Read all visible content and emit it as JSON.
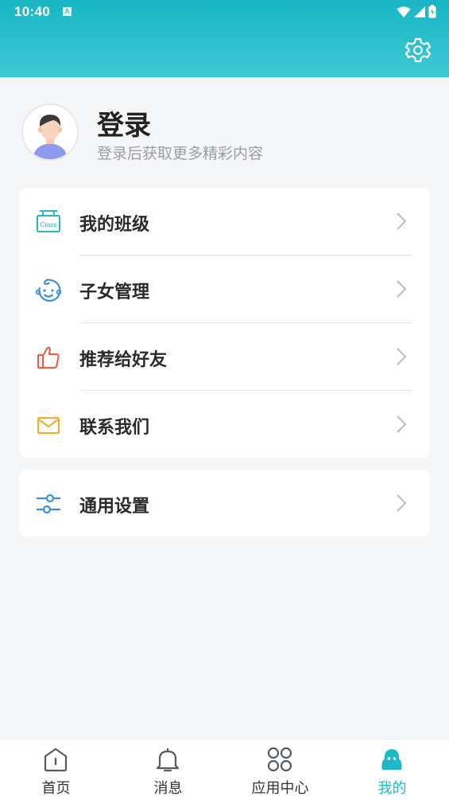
{
  "status_bar": {
    "time": "10:40",
    "badge": "A"
  },
  "header": {
    "settings_icon": "gear-icon"
  },
  "profile": {
    "title": "登录",
    "subtitle": "登录后获取更多精彩内容"
  },
  "menu": [
    {
      "label": "我的班级",
      "icon": "class-board-icon"
    },
    {
      "label": "子女管理",
      "icon": "baby-face-icon"
    },
    {
      "label": "推荐给好友",
      "icon": "thumbs-up-icon"
    },
    {
      "label": "联系我们",
      "icon": "mail-icon"
    }
  ],
  "settings_menu": {
    "label": "通用设置",
    "icon": "sliders-icon"
  },
  "tabs": [
    {
      "label": "首页",
      "icon": "home-icon"
    },
    {
      "label": "消息",
      "icon": "bell-icon"
    },
    {
      "label": "应用中心",
      "icon": "apps-grid-icon"
    },
    {
      "label": "我的",
      "icon": "user-icon",
      "active": true
    }
  ],
  "colors": {
    "accent": "#1fb8c7",
    "header_top": "#19b6c5",
    "header_bottom": "#3ec8d6"
  }
}
